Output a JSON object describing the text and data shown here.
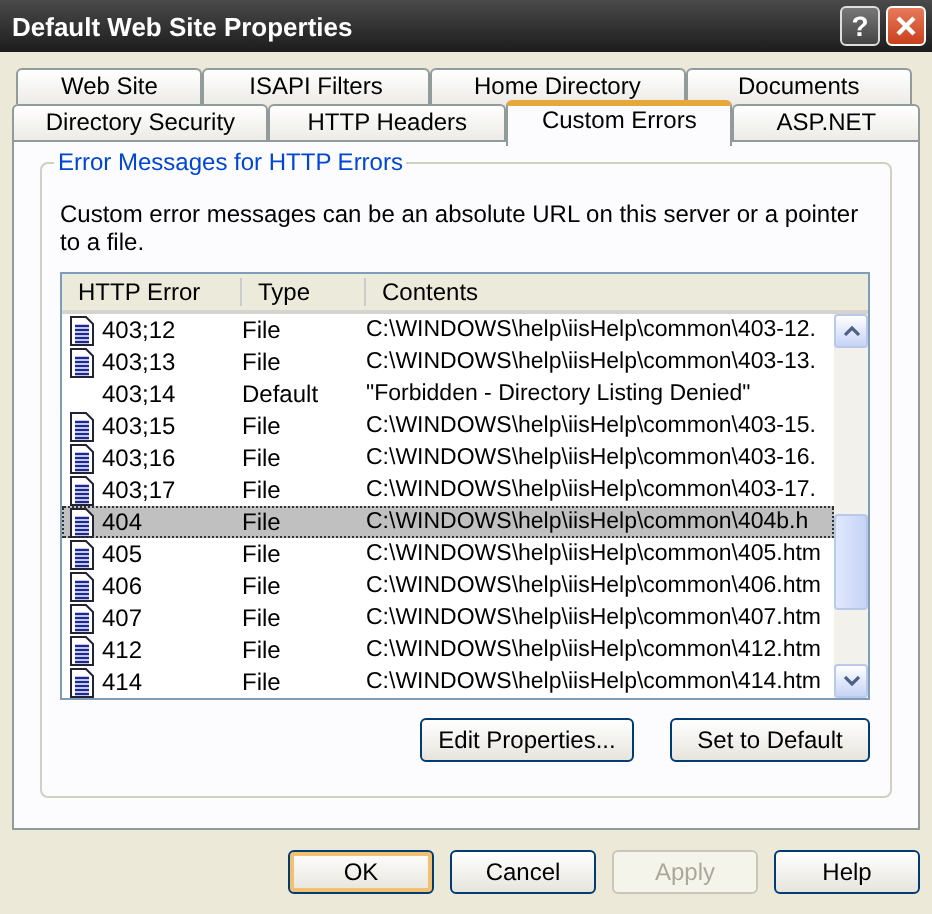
{
  "window": {
    "title": "Default Web Site Properties",
    "help_glyph": "?"
  },
  "tab_rows": [
    [
      {
        "label": "Web Site",
        "selected": false
      },
      {
        "label": "ISAPI Filters",
        "selected": false
      },
      {
        "label": "Home Directory",
        "selected": false
      },
      {
        "label": "Documents",
        "selected": false
      }
    ],
    [
      {
        "label": "Directory Security",
        "selected": false
      },
      {
        "label": "HTTP Headers",
        "selected": false
      },
      {
        "label": "Custom Errors",
        "selected": true
      },
      {
        "label": "ASP.NET",
        "selected": false
      }
    ]
  ],
  "group": {
    "title": "Error Messages for HTTP Errors",
    "description": "Custom error messages can be an absolute URL on this server or a pointer to a file.",
    "columns": [
      "HTTP Error",
      "Type",
      "Contents"
    ],
    "rows": [
      {
        "code": "403;12",
        "type": "File",
        "contents": "C:\\WINDOWS\\help\\iisHelp\\common\\403-12.",
        "has_icon": true,
        "selected": false
      },
      {
        "code": "403;13",
        "type": "File",
        "contents": "C:\\WINDOWS\\help\\iisHelp\\common\\403-13.",
        "has_icon": true,
        "selected": false
      },
      {
        "code": "403;14",
        "type": "Default",
        "contents": "\"Forbidden - Directory Listing Denied\"",
        "has_icon": false,
        "selected": false
      },
      {
        "code": "403;15",
        "type": "File",
        "contents": "C:\\WINDOWS\\help\\iisHelp\\common\\403-15.",
        "has_icon": true,
        "selected": false
      },
      {
        "code": "403;16",
        "type": "File",
        "contents": "C:\\WINDOWS\\help\\iisHelp\\common\\403-16.",
        "has_icon": true,
        "selected": false
      },
      {
        "code": "403;17",
        "type": "File",
        "contents": "C:\\WINDOWS\\help\\iisHelp\\common\\403-17.",
        "has_icon": true,
        "selected": false
      },
      {
        "code": "404",
        "type": "File",
        "contents": "C:\\WINDOWS\\help\\iisHelp\\common\\404b.h",
        "has_icon": true,
        "selected": true
      },
      {
        "code": "405",
        "type": "File",
        "contents": "C:\\WINDOWS\\help\\iisHelp\\common\\405.htm",
        "has_icon": true,
        "selected": false
      },
      {
        "code": "406",
        "type": "File",
        "contents": "C:\\WINDOWS\\help\\iisHelp\\common\\406.htm",
        "has_icon": true,
        "selected": false
      },
      {
        "code": "407",
        "type": "File",
        "contents": "C:\\WINDOWS\\help\\iisHelp\\common\\407.htm",
        "has_icon": true,
        "selected": false
      },
      {
        "code": "412",
        "type": "File",
        "contents": "C:\\WINDOWS\\help\\iisHelp\\common\\412.htm",
        "has_icon": true,
        "selected": false
      },
      {
        "code": "414",
        "type": "File",
        "contents": "C:\\WINDOWS\\help\\iisHelp\\common\\414.htm",
        "has_icon": true,
        "selected": false
      }
    ],
    "buttons": [
      {
        "label": "Edit Properties..."
      },
      {
        "label": "Set to Default"
      }
    ]
  },
  "dialog_buttons": [
    {
      "label": "OK",
      "default": true,
      "disabled": false
    },
    {
      "label": "Cancel",
      "default": false,
      "disabled": false
    },
    {
      "label": "Apply",
      "default": false,
      "disabled": true
    },
    {
      "label": "Help",
      "default": false,
      "disabled": false
    }
  ]
}
